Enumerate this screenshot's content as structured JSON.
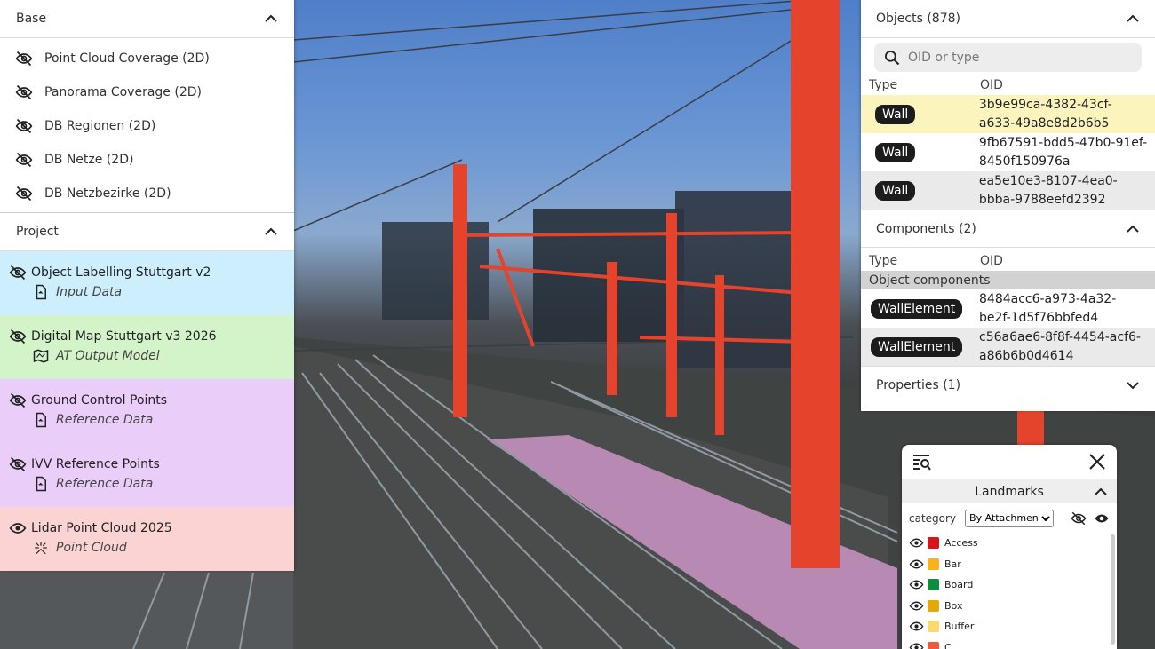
{
  "base": {
    "title": "Base",
    "items": [
      {
        "label": "Point Cloud Coverage (2D)"
      },
      {
        "label": "Panorama Coverage (2D)"
      },
      {
        "label": "DB Regionen (2D)"
      },
      {
        "label": "DB Netze (2D)"
      },
      {
        "label": "DB Netzbezirke (2D)"
      }
    ]
  },
  "project": {
    "title": "Project",
    "items": [
      {
        "name": "Object Labelling Stuttgart v2",
        "sub": "Input Data",
        "color": "#cdeefc",
        "visible": false,
        "sub_icon": "file-import-icon"
      },
      {
        "name": "Digital Map Stuttgart v3 2026",
        "sub": "AT Output Model",
        "color": "#d3f3c9",
        "visible": false,
        "sub_icon": "map-icon"
      },
      {
        "name": "Ground Control Points",
        "sub": "Reference Data",
        "color": "#ebcdfa",
        "visible": false,
        "sub_icon": "file-import-icon"
      },
      {
        "name": "IVV Reference Points",
        "sub": "Reference Data",
        "color": "#ebcdfa",
        "visible": false,
        "sub_icon": "file-import-icon"
      },
      {
        "name": "Lidar Point Cloud 2025",
        "sub": "Point Cloud",
        "color": "#fbd3d3",
        "visible": true,
        "sub_icon": "scatter-icon"
      }
    ]
  },
  "objects": {
    "title": "Objects (878)",
    "search_placeholder": "OID or type",
    "col_type": "Type",
    "col_oid": "OID",
    "rows": [
      {
        "type": "Wall",
        "oid_line1": "3b9e99ca-4382-43cf-",
        "oid_line2": "a633-49a8e8d2b6b5"
      },
      {
        "type": "Wall",
        "oid_line1": "9fb67591-bdd5-47b0-91ef-",
        "oid_line2": "8450f150976a"
      },
      {
        "type": "Wall",
        "oid_line1": "ea5e10e3-8107-4ea0-",
        "oid_line2": "bbba-9788eefd2392"
      }
    ]
  },
  "components": {
    "title": "Components (2)",
    "col_type": "Type",
    "col_oid": "OID",
    "subheader": "Object components",
    "rows": [
      {
        "type": "WallElement",
        "oid_line1": "8484acc6-a973-4a32-",
        "oid_line2": "be2f-1d5f76bbfed4"
      },
      {
        "type": "WallElement",
        "oid_line1": "c56a6ae6-8f8f-4454-acf6-",
        "oid_line2": "a86b6b0d4614"
      }
    ]
  },
  "properties": {
    "title": "Properties (1)"
  },
  "landmarks": {
    "title": "Landmarks",
    "filter_label": "category",
    "filter_value": "By Attachment",
    "items": [
      {
        "label": "Access",
        "color": "#d9141b"
      },
      {
        "label": "Bar",
        "color": "#f6b31c"
      },
      {
        "label": "Board",
        "color": "#0f8d3e"
      },
      {
        "label": "Box",
        "color": "#e2a90a"
      },
      {
        "label": "Buffer",
        "color": "#fbd96a"
      },
      {
        "label": "C",
        "color": "#ee5b3a"
      }
    ]
  }
}
